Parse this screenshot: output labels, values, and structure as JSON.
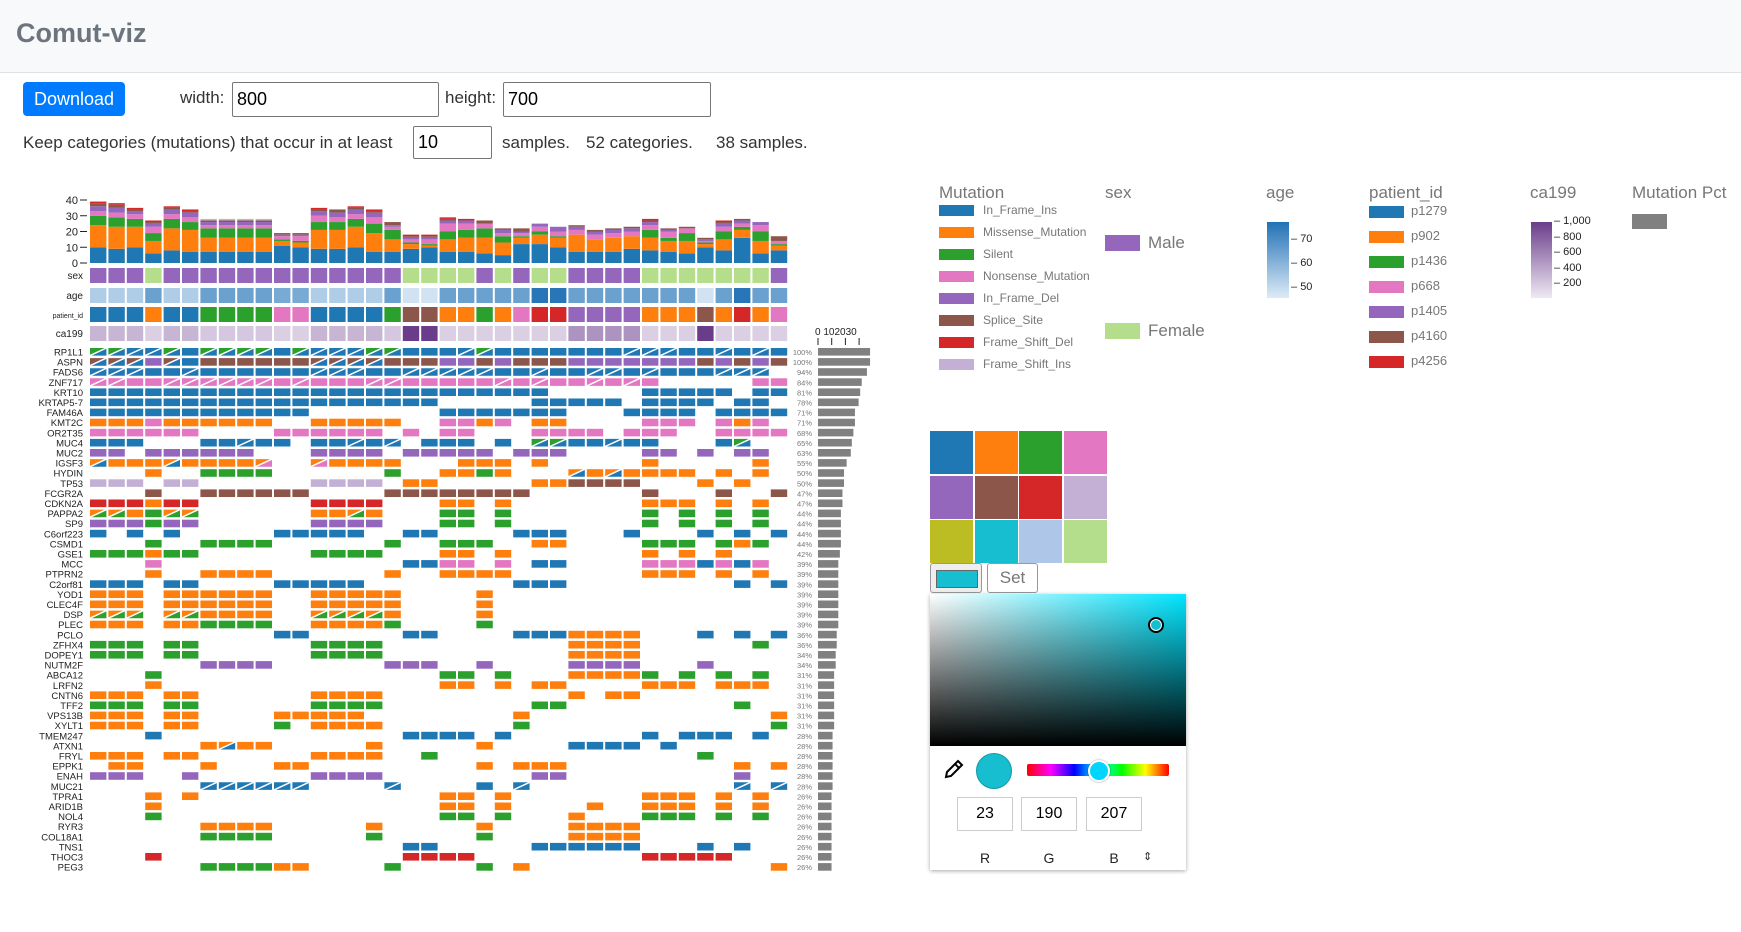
{
  "header": {
    "title": "Comut-viz"
  },
  "toolbar": {
    "download_label": "Download",
    "width_label": "width:",
    "width_value": "800",
    "height_label": "height:",
    "height_value": "700"
  },
  "filter": {
    "prefix": "Keep categories (mutations) that occur in at least",
    "min_samples": "10",
    "suffix": "samples.",
    "categories_text": "52 categories.",
    "samples_text": "38 samples."
  },
  "chart_data": {
    "type": "comut",
    "bar_axis_ticks": [
      0,
      10,
      20,
      30,
      40
    ],
    "pct_axis_ticks": [
      0,
      10,
      20,
      30
    ],
    "pct_axis_label": "0 102030",
    "mutation_types": [
      "In_Frame_Ins",
      "Missense_Mutation",
      "Silent",
      "Nonsense_Mutation",
      "In_Frame_Del",
      "Splice_Site",
      "Frame_Shift_Del",
      "Frame_Shift_Ins"
    ],
    "mutation_colors": {
      "In_Frame_Ins": "#1f77b4",
      "Missense_Mutation": "#ff7f0e",
      "Silent": "#2ca02c",
      "Nonsense_Mutation": "#e377c2",
      "In_Frame_Del": "#9467bd",
      "Splice_Site": "#8c564b",
      "Frame_Shift_Del": "#d62728",
      "Frame_Shift_Ins": "#c5b0d5"
    },
    "cell_codes": {
      "B": "In_Frame_Ins",
      "O": "Missense_Mutation",
      "G": "Silent",
      "P": "Nonsense_Mutation",
      "U": "In_Frame_Del",
      "N": "Splice_Site",
      "R": "Frame_Shift_Del",
      "L": "Frame_Shift_Ins"
    },
    "sample_mutation_counts": [
      [
        10,
        14,
        6,
        3,
        3,
        2,
        1,
        0
      ],
      [
        9,
        14,
        6,
        3,
        3,
        2,
        1,
        0
      ],
      [
        10,
        13,
        5,
        3,
        2,
        1,
        1,
        0
      ],
      [
        6,
        8,
        5,
        4,
        2,
        1,
        1,
        0
      ],
      [
        8,
        14,
        6,
        3,
        3,
        1,
        1,
        0
      ],
      [
        7,
        14,
        5,
        3,
        3,
        1,
        1,
        0
      ],
      [
        7,
        9,
        6,
        2,
        2,
        1,
        0,
        1
      ],
      [
        7,
        9,
        6,
        2,
        2,
        1,
        0,
        1
      ],
      [
        7,
        9,
        6,
        2,
        2,
        1,
        0,
        1
      ],
      [
        7,
        9,
        6,
        2,
        2,
        1,
        0,
        1
      ],
      [
        11,
        3,
        1,
        2,
        1,
        1,
        0,
        0
      ],
      [
        10,
        3,
        1,
        3,
        1,
        1,
        0,
        0
      ],
      [
        9,
        12,
        5,
        4,
        3,
        1,
        1,
        0
      ],
      [
        9,
        12,
        5,
        3,
        3,
        2,
        0,
        0
      ],
      [
        10,
        13,
        5,
        3,
        3,
        1,
        1,
        0
      ],
      [
        7,
        12,
        6,
        4,
        3,
        1,
        1,
        0
      ],
      [
        7,
        8,
        6,
        2,
        1,
        2,
        0,
        0
      ],
      [
        9,
        3,
        1,
        2,
        1,
        1,
        1,
        0
      ],
      [
        10,
        1,
        1,
        3,
        1,
        1,
        1,
        0
      ],
      [
        7,
        8,
        5,
        5,
        2,
        1,
        1,
        0
      ],
      [
        7,
        9,
        5,
        4,
        2,
        0,
        1,
        0
      ],
      [
        6,
        10,
        6,
        3,
        0,
        2,
        0,
        0
      ],
      [
        5,
        8,
        4,
        2,
        2,
        1,
        0,
        0
      ],
      [
        12,
        4,
        1,
        2,
        1,
        2,
        0,
        0
      ],
      [
        12,
        6,
        2,
        3,
        2,
        0,
        0,
        0
      ],
      [
        10,
        6,
        1,
        3,
        3,
        0,
        0,
        0
      ],
      [
        7,
        11,
        0,
        3,
        2,
        1,
        0,
        0
      ],
      [
        7,
        8,
        0,
        3,
        2,
        1,
        0,
        0
      ],
      [
        7,
        9,
        0,
        3,
        2,
        1,
        0,
        0
      ],
      [
        9,
        8,
        0,
        3,
        2,
        1,
        0,
        0
      ],
      [
        8,
        8,
        5,
        3,
        2,
        1,
        1,
        0
      ],
      [
        7,
        7,
        2,
        4,
        1,
        1,
        0,
        0
      ],
      [
        6,
        8,
        5,
        3,
        0,
        1,
        0,
        0
      ],
      [
        10,
        2,
        1,
        1,
        1,
        1,
        0,
        0
      ],
      [
        8,
        7,
        5,
        3,
        2,
        1,
        1,
        0
      ],
      [
        16,
        5,
        2,
        2,
        2,
        1,
        0,
        0
      ],
      [
        6,
        8,
        6,
        4,
        2,
        0,
        0,
        0
      ],
      [
        8,
        3,
        1,
        2,
        0,
        3,
        0,
        0
      ]
    ],
    "annotation_labels": [
      "sex",
      "age",
      "patient_id",
      "ca199"
    ],
    "annotations": {
      "sex": [
        "Male",
        "Male",
        "Male",
        "Female",
        "Male",
        "Male",
        "Male",
        "Male",
        "Male",
        "Male",
        "Male",
        "Male",
        "Male",
        "Male",
        "Male",
        "Male",
        "Male",
        "Female",
        "Female",
        "Female",
        "Female",
        "Male",
        "Female",
        "Male",
        "Female",
        "Female",
        "Male",
        "Male",
        "Male",
        "Male",
        "Female",
        "Female",
        "Female",
        "Female",
        "Female",
        "Female",
        "Female",
        "Male"
      ],
      "age": [
        52,
        52,
        52,
        62,
        52,
        52,
        62,
        62,
        62,
        62,
        60,
        60,
        52,
        52,
        52,
        52,
        62,
        47,
        47,
        62,
        62,
        62,
        62,
        62,
        72,
        72,
        62,
        62,
        62,
        62,
        62,
        62,
        62,
        47,
        62,
        72,
        62,
        62
      ],
      "patient_id": [
        "p1279",
        "p1279",
        "p1279",
        "p902",
        "p1279",
        "p1279",
        "p1436",
        "p1436",
        "p1436",
        "p1436",
        "p668",
        "p668",
        "p1279",
        "p1279",
        "p1279",
        "p1279",
        "p1436",
        "p4160",
        "p4160",
        "p902",
        "p902",
        "p1436",
        "p902",
        "p668",
        "p4256",
        "p4256",
        "p1405",
        "p1405",
        "p1405",
        "p1405",
        "p902",
        "p902",
        "p902",
        "p4160",
        "p902",
        "p4256",
        "p902",
        "p668"
      ],
      "ca199": [
        300,
        300,
        300,
        150,
        300,
        300,
        200,
        200,
        200,
        200,
        150,
        150,
        300,
        300,
        300,
        300,
        200,
        1000,
        1000,
        150,
        150,
        150,
        150,
        150,
        150,
        150,
        500,
        500,
        500,
        500,
        150,
        150,
        150,
        1000,
        150,
        150,
        150,
        150
      ]
    },
    "genes": [
      {
        "name": "RP1L1",
        "pct": "100%",
        "cells": "G/B G/B B/B B/B G/B B G/B G/B G/B G/B B G/B B/B B/B B/B G/B G/B B B B B/B G/B B B B B B B B B/B B/B B/B B B B/B B B/B B"
      },
      {
        "name": "ASPN",
        "pct": "100%",
        "cells": "N/B N/B N/B U N/B B N N N N N N N/B N/B N/B N/B N N N U U N U N N N U U U U U U U N U N U N"
      },
      {
        "name": "FADS6",
        "pct": "94%",
        "cells": "B/B B/B B/B B B B/B B B B B B B B/B B/B B/B B B B/B B/B B/B B/B B/B B B B/B B B B/B B/B B B/B B B B B/B B/B B/B ."
      },
      {
        "name": "ZNF717",
        "pct": "84%",
        "cells": "P/P P/P P P P/P P/P P/P P/P P/P P/P P P/P P P P P/P P/P P P P P P P/P P P/P P P P/P P P/P P . . . . . P P"
      },
      {
        "name": "KRT10",
        "pct": "81%",
        "cells": "B B B B B B B B B B B B B B B B B B B B B B B B B . . . . . B B B B B . B B"
      },
      {
        "name": "KRTAP5-7",
        "pct": "78%",
        "cells": "B B B B B B B B B B B B B B B B B B B . . . . . B B B B B . B B B B . B B ."
      },
      {
        "name": "FAM46A",
        "pct": "71%",
        "cells": "B B B B B B B B B B B B . . . . . . . B B B B B B B . . . B B B B . B B B B"
      },
      {
        "name": "KMT2C",
        "pct": "71%",
        "cells": "O O O P O O O O O O . . O O O O O . . P P O P . O O . . . . P P P . P O P ."
      },
      {
        "name": "OR2T35",
        "pct": "68%",
        "cells": "P P P P P P . . . . P P P P P P . P . P P . . . P P P P . P P P . . P P P P"
      },
      {
        "name": "MUC4",
        "pct": "65%",
        "cells": "B B B . . . B B B/B B B . B B B/B B B/B . B B B . B . G/B G/B B B B/B B B . . . B G/B . ."
      },
      {
        "name": "MUC2",
        "pct": "63%",
        "cells": "U U . U U U U U U . . . U U U U . U U U U U . U U U . . . . U U . U . U U ."
      },
      {
        "name": "IGSF3",
        "pct": "55%",
        "cells": "O/B O O O O/B O O O O O/P . . O/P O O O O . . . O O O . O . . . . . O . . . . . O ."
      },
      {
        "name": "HYDIN",
        "pct": "50%",
        "cells": ". . . O . . G G G G . . . . . . G . . O O G O . . . O/B O O/B O O O O . O . O ."
      },
      {
        "name": "TP53",
        "pct": "50%",
        "cells": "L L L . L L . . . . . . L L L L . O O . . . . . O O N N N N . . . O . O . ."
      },
      {
        "name": "FCGR2A",
        "pct": "47%",
        "cells": ". . . N . . N N N N N N . . . . N N N N N N N N . . . . . . N . . . N . . N"
      },
      {
        "name": "CDKN2A",
        "pct": "47%",
        "cells": "R R R O R R . . . . . . R R R R . . . O O . O . . . . . . . O O O . O . O ."
      },
      {
        "name": "PAPPA2",
        "pct": "44%",
        "cells": "O/G O/G O G O/G O/G . . . . . . O O O/G O . . . G G . G . . . . . . . G . G . G . G ."
      },
      {
        "name": "SP9",
        "pct": "44%",
        "cells": "U U U G U U . . . . . . U U U U . . . G G . G . . . . . . . G . G . G . G ."
      },
      {
        "name": "C6orf223",
        "pct": "44%",
        "cells": "B . B . B . . . . . B B B B B . . B B . . . . B B B . . . B . . . B . B . B"
      },
      {
        "name": "CSMD1",
        "pct": "44%",
        "cells": ". . . G . . G G G G . . . . . . G . . G G G . . O O . . . . G G G . G O G ."
      },
      {
        "name": "GSE1",
        "pct": "42%",
        "cells": "G G G O G G . . . . . . G G G G . . . O O . O . . . . . . . O . O . O . . ."
      },
      {
        "name": "MCC",
        "pct": "39%",
        "cells": ". . . P . . . . . . . . . . . . . B B P P . P . B B . . . . P P P B P B P ."
      },
      {
        "name": "PTPRN2",
        "pct": "39%",
        "cells": ". . . O . . O O O O . . . . . . O . . O O O O . . . . . . . O O O . O . O ."
      },
      {
        "name": "C2orf81",
        "pct": "39%",
        "cells": "B B B . B B . . . . B B B B B . . . . . . . . B B B . . . . . . . . . B . B"
      },
      {
        "name": "YOD1",
        "pct": "39%",
        "cells": "O O O . O O O O O O . . O O O O O . . . . O . . . . . . . . . . . . . . . ."
      },
      {
        "name": "CLEC4F",
        "pct": "39%",
        "cells": "O O O . O O O O O O . . O O O O O . . . . O . . . . . . . . . . . . . . . ."
      },
      {
        "name": "DSP",
        "pct": "39%",
        "cells": "O/G O/G O/G . O/G O/G O O O O . . O/G O/G O/G O/G O . . . . O . . . . . . . . . . . . . . . ."
      },
      {
        "name": "PLEC",
        "pct": "39%",
        "cells": "O O O . O O G G G G . . O O O O G . . . . G . . . . . . . . . . . . . . . ."
      },
      {
        "name": "PCLO",
        "pct": "36%",
        "cells": ". . . . . . . . . . B B . . . . . B B . . . . B B B O O O O . . . B . B . B"
      },
      {
        "name": "ZFHX4",
        "pct": "36%",
        "cells": "G G G . G G . . . . . . G G G G . . . . . . . . . . O O O O . . . . . . G ."
      },
      {
        "name": "DOPEY1",
        "pct": "34%",
        "cells": "G G G . G G . . . . . . G G G G . . . . . . . . . . O O O O . . . . . . . ."
      },
      {
        "name": "NUTM2F",
        "pct": "34%",
        "cells": ". . . . . . U U U U . . . . . . U U U . . U . . . . U U U U . . . U . . . ."
      },
      {
        "name": "ABCA12",
        "pct": "31%",
        "cells": ". . . G . . . . . . . . . . . . . . . G G . G . . . O O O O G . G . G . G ."
      },
      {
        "name": "LRFN2",
        "pct": "31%",
        "cells": ". . . O . . . . . . . . . . . . . . . O O . O . O O . . . . O O O . O O O ."
      },
      {
        "name": "CNTN6",
        "pct": "31%",
        "cells": "O O O . O O . . . . . . O O O O . . . . . . . . . . O . O O . . . . . . . ."
      },
      {
        "name": "TFF2",
        "pct": "31%",
        "cells": "G G G . G G . . . . . . G G G G . . . . . . . . G G . . . . . . . . . G . ."
      },
      {
        "name": "VPS13B",
        "pct": "31%",
        "cells": "O O O . O O . . . . O O O O O . . . . . . . . O . . . . . . . . . . . . . O"
      },
      {
        "name": "XYLT1",
        "pct": "31%",
        "cells": "O O O . O O . . . . G . O O O O . . . . . . . G . . . . . . . . . . . . . G"
      },
      {
        "name": "TMEM247",
        "pct": "28%",
        "cells": ". . . B . . . . . . . . . . . . . B B B B . B . . . . . . . B . B B B . B ."
      },
      {
        "name": "ATXN1",
        "pct": "28%",
        "cells": ". . . . . . O O/B O O . . . . . O . . . . . O . . . . B B B B . B . . . . . ."
      },
      {
        "name": "FRYL",
        "pct": "28%",
        "cells": "O O O . O O . . . . . . O O O O . . G . . . . . . . . . . . . . . G . . . ."
      },
      {
        "name": "EPPK1",
        "pct": "28%",
        "cells": ". O O . . . O . . . O O . . . . . . . . . O . O O O . . . . . . . . . O . O"
      },
      {
        "name": "ENAH",
        "pct": "28%",
        "cells": "U U U . . U . . . . . . U U U U . . . . . . . . U U . . . . . . . . . U . ."
      },
      {
        "name": "MUC21",
        "pct": "28%",
        "cells": ". . . . . . B/B B/B B/B B/B B/B B/B . . . . B/B . . . . B . B/B . . . . . . . . . . . B/B . B/B"
      },
      {
        "name": "TPRA1",
        "pct": "26%",
        "cells": ". . . O . O . . . . . . . . . . . . . O O . O . . . . . . . O O O . O . O ."
      },
      {
        "name": "ARID1B",
        "pct": "26%",
        "cells": ". . . O . . . . . . . . . . . . . . . O O . O . . . . O . . O O O . O . O ."
      },
      {
        "name": "NOL4",
        "pct": "26%",
        "cells": ". . . G . . . . . . . . . . . . . . . G G . G . . . O . . . G G G . G . G ."
      },
      {
        "name": "RYR3",
        "pct": "26%",
        "cells": ". . . . . . O O O O . . . . . O . . . . . O . . . . O O O O . . . . . . . ."
      },
      {
        "name": "COL18A1",
        "pct": "26%",
        "cells": ". . . . . . G G G G . . . . . G . . . . . G . . . . O O O O . . . . . . . ."
      },
      {
        "name": "TNS1",
        "pct": "26%",
        "cells": ". . . . . . . . . . . . . . . . . B B . . . . . B B B B B B . . . B . B . ."
      },
      {
        "name": "THOC3",
        "pct": "26%",
        "cells": ". . . R . . . . . . . . . . . . . R R R R . . . . . . . . . R R R R R . . ."
      },
      {
        "name": "PEG3",
        "pct": "26%",
        "cells": ". . . . . . G G G G O O . . . . G . . . . G . O . . . . . . . . . . . . . O"
      }
    ]
  },
  "legend": {
    "mutation": {
      "title": "Mutation",
      "items": [
        "In_Frame_Ins",
        "Missense_Mutation",
        "Silent",
        "Nonsense_Mutation",
        "In_Frame_Del",
        "Splice_Site",
        "Frame_Shift_Del",
        "Frame_Shift_Ins"
      ]
    },
    "sex": {
      "title": "sex",
      "items": [
        {
          "label": "Male",
          "color": "#9467bd"
        },
        {
          "label": "Female",
          "color": "#b5de8c"
        }
      ]
    },
    "age": {
      "title": "age",
      "ticks": [
        "70",
        "60",
        "50"
      ],
      "color_low": "#deebf7",
      "color_high": "#2171b5"
    },
    "patient_id": {
      "title": "patient_id",
      "items": [
        {
          "label": "p1279",
          "color": "#1f77b4"
        },
        {
          "label": "p902",
          "color": "#ff7f0e"
        },
        {
          "label": "p1436",
          "color": "#2ca02c"
        },
        {
          "label": "p668",
          "color": "#e377c2"
        },
        {
          "label": "p1405",
          "color": "#9467bd"
        },
        {
          "label": "p4160",
          "color": "#8c564b"
        },
        {
          "label": "p4256",
          "color": "#d62728"
        }
      ]
    },
    "ca199": {
      "title": "ca199",
      "ticks": [
        "1,000",
        "800",
        "600",
        "400",
        "200"
      ],
      "color_low": "#efe9f4",
      "color_high": "#6a3d8a"
    },
    "mutation_pct": {
      "title": "Mutation Pct",
      "color": "#808080"
    }
  },
  "palette": {
    "colors": [
      "#1f77b4",
      "#ff7f0e",
      "#2ca02c",
      "#e377c2",
      "#9467bd",
      "#8c564b",
      "#d62728",
      "#c5b0d5",
      "#bcbd22",
      "#17becf",
      "#aec7e8",
      "#b5de8c"
    ]
  },
  "picker": {
    "current_color": "#17becf",
    "set_label": "Set",
    "r": "23",
    "g": "190",
    "b": "207",
    "r_label": "R",
    "g_label": "G",
    "b_label": "B",
    "mode_toggle": "⇕"
  }
}
